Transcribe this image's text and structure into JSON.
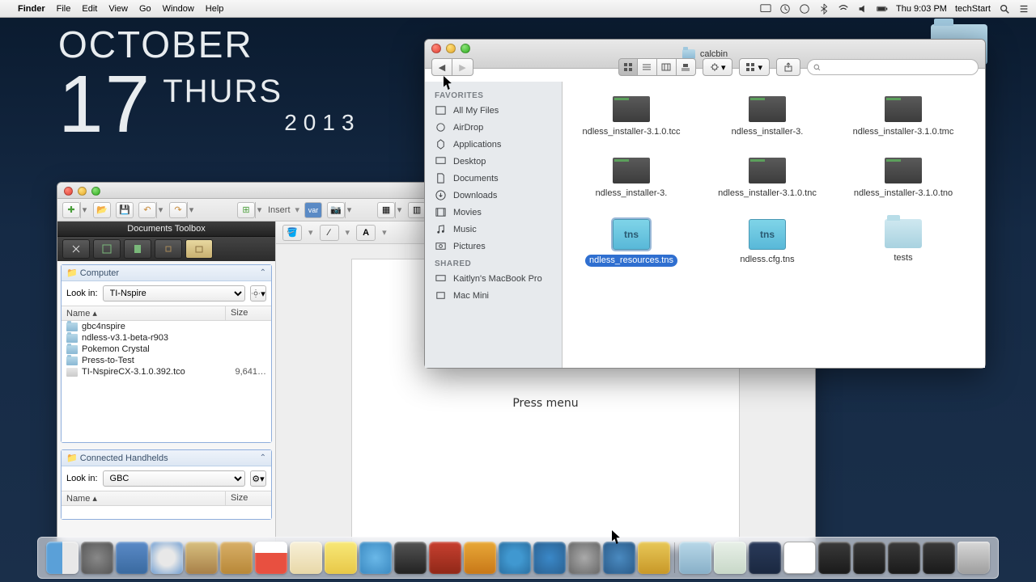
{
  "menubar": {
    "app": "Finder",
    "items": [
      "File",
      "Edit",
      "View",
      "Go",
      "Window",
      "Help"
    ],
    "right": {
      "time": "Thu 9:03 PM",
      "user": "techStart"
    }
  },
  "desktop": {
    "month": "OCTOBER",
    "day": "17",
    "dow": "THURSDAY",
    "year": "2013"
  },
  "finder": {
    "title": "calcbin",
    "sidebar": {
      "favorites_head": "FAVORITES",
      "favorites": [
        "All My Files",
        "AirDrop",
        "Applications",
        "Desktop",
        "Documents",
        "Downloads",
        "Movies",
        "Music",
        "Pictures"
      ],
      "shared_head": "SHARED",
      "shared": [
        "Kaitlyn's MacBook Pro",
        "Mac Mini"
      ]
    },
    "files": [
      {
        "name": "ndless_installer-3.1.0.tcc",
        "kind": "blk"
      },
      {
        "name": "ndless_installer-3.",
        "kind": "blk"
      },
      {
        "name": "ndless_installer-3.1.0.tmc",
        "kind": "blk"
      },
      {
        "name": "ndless_installer-3.",
        "kind": "blk"
      },
      {
        "name": "ndless_installer-3.1.0.tnc",
        "kind": "blk"
      },
      {
        "name": "ndless_installer-3.1.0.tno",
        "kind": "blk"
      },
      {
        "name": "ndless_resources.tns",
        "kind": "tns",
        "selected": true
      },
      {
        "name": "ndless.cfg.tns",
        "kind": "tns"
      },
      {
        "name": "tests",
        "kind": "fldl"
      }
    ]
  },
  "tiapp": {
    "toolbox_title": "Documents Toolbox",
    "insert_label": "Insert",
    "panel1": {
      "title": "Computer",
      "lookin_label": "Look in:",
      "lookin_value": "TI-Nspire",
      "cols": {
        "name": "Name",
        "size": "Size"
      },
      "rows": [
        {
          "name": "gbc4nspire",
          "size": "",
          "kind": "fld"
        },
        {
          "name": "ndless-v3.1-beta-r903",
          "size": "",
          "kind": "fld"
        },
        {
          "name": "Pokemon Crystal",
          "size": "",
          "kind": "fld"
        },
        {
          "name": "Press-to-Test",
          "size": "",
          "kind": "fld"
        },
        {
          "name": "TI-NspireCX-3.1.0.392.tco",
          "size": "9,641…",
          "kind": "doc"
        }
      ]
    },
    "panel2": {
      "title": "Connected Handhelds",
      "lookin_label": "Look in:",
      "lookin_value": "GBC",
      "cols": {
        "name": "Name",
        "size": "Size"
      }
    },
    "screen_msg": "Press menu"
  }
}
